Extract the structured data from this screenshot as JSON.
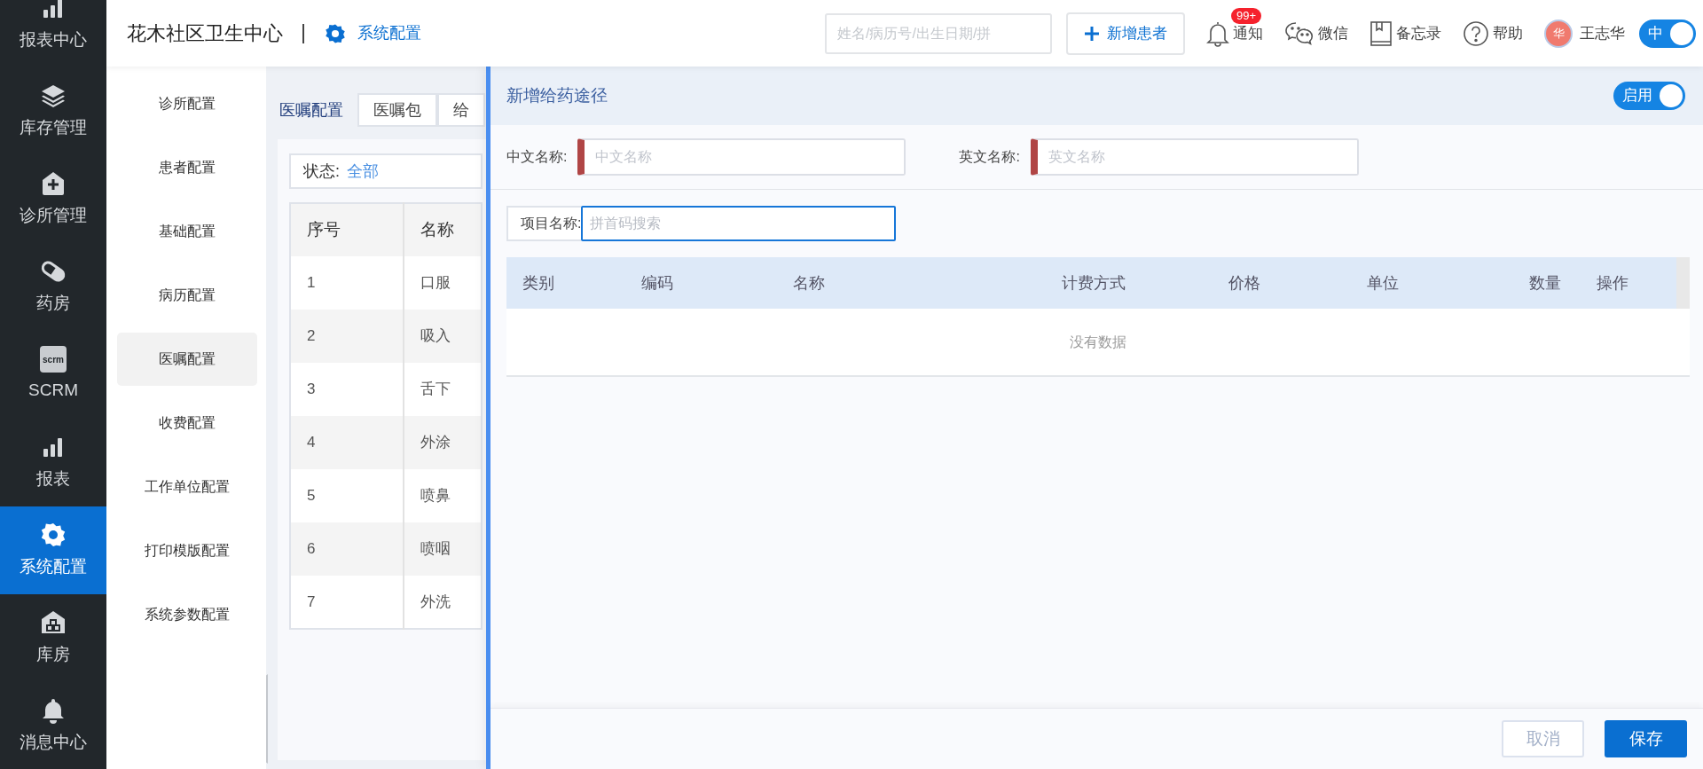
{
  "nav_rail": {
    "items": [
      {
        "label": "报表中心",
        "selected": false
      },
      {
        "label": "库存管理",
        "selected": false
      },
      {
        "label": "诊所管理",
        "selected": false
      },
      {
        "label": "药房",
        "selected": false
      },
      {
        "label": "SCRM",
        "selected": false,
        "icon_text": "scrm"
      },
      {
        "label": "报表",
        "selected": false
      },
      {
        "label": "系统配置",
        "selected": true
      },
      {
        "label": "库房",
        "selected": false
      },
      {
        "label": "消息中心",
        "selected": false
      }
    ]
  },
  "header": {
    "title": "花木社区卫生中心",
    "section": "系统配置",
    "search": {
      "placeholder": "姓名/病历号/出生日期/拼"
    },
    "new_patient_button": "新增患者",
    "tools": [
      {
        "label": "通知",
        "badge": "99+"
      },
      {
        "label": "微信"
      },
      {
        "label": "备忘录"
      },
      {
        "label": "帮助"
      }
    ],
    "user": {
      "avatar": "华",
      "name": "王志华"
    },
    "language_toggle": {
      "label": "中",
      "on": true
    }
  },
  "submenu": {
    "items": [
      {
        "label": "诊所配置",
        "selected": false
      },
      {
        "label": "患者配置",
        "selected": false
      },
      {
        "label": "基础配置",
        "selected": false
      },
      {
        "label": "病历配置",
        "selected": false
      },
      {
        "label": "医嘱配置",
        "selected": true
      },
      {
        "label": "收费配置",
        "selected": false
      },
      {
        "label": "工作单位配置",
        "selected": false
      },
      {
        "label": "打印模版配置",
        "selected": false
      },
      {
        "label": "系统参数配置",
        "selected": false
      }
    ]
  },
  "content": {
    "tabs": [
      {
        "label": "医嘱配置",
        "selected": true
      },
      {
        "label": "医嘱包",
        "selected": false
      },
      {
        "label": "给",
        "selected": false
      }
    ],
    "status_filter": {
      "label": "状态:",
      "value": "全部"
    },
    "table": {
      "columns": [
        "序号",
        "名称"
      ],
      "rows": [
        [
          "1",
          "口服"
        ],
        [
          "2",
          "吸入"
        ],
        [
          "3",
          "舌下"
        ],
        [
          "4",
          "外涂"
        ],
        [
          "5",
          "喷鼻"
        ],
        [
          "6",
          "喷咽"
        ],
        [
          "7",
          "外洗"
        ]
      ]
    }
  },
  "panel": {
    "title": "新增给药途径",
    "enabled_toggle": {
      "label": "启用",
      "on": true
    },
    "fields": [
      {
        "label": "中文名称:",
        "placeholder": "中文名称",
        "required": true
      },
      {
        "label": "英文名称:",
        "placeholder": "英文名称",
        "required": true
      }
    ],
    "item_search": {
      "label": "项目名称:",
      "placeholder": "拼首码搜索"
    },
    "table": {
      "columns": [
        "类别",
        "编码",
        "名称",
        "计费方式",
        "价格",
        "单位",
        "数量",
        "操作"
      ],
      "empty_text": "没有数据"
    },
    "buttons": [
      {
        "label": "取消",
        "kind": "cancel"
      },
      {
        "label": "保存",
        "kind": "primary"
      }
    ]
  }
}
